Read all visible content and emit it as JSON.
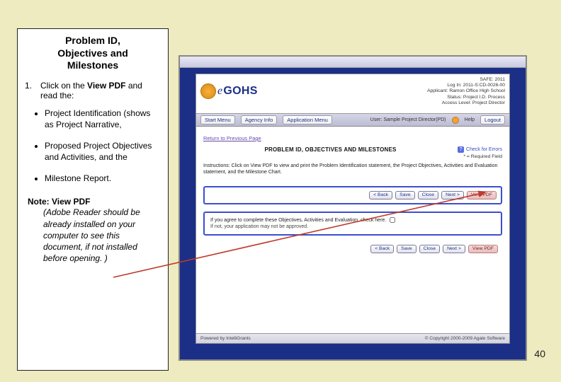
{
  "slide_number": "40",
  "panel": {
    "title_l1": "Problem ID,",
    "title_l2": "Objectives and",
    "title_l3": "Milestones",
    "step_num": "1.",
    "step_prefix": "Click on the ",
    "step_bold": "View PDF",
    "step_suffix": " and read  the:",
    "bullets": [
      "Project Identification (shows as Project Narrative,",
      "Proposed Project Objectives and Activities, and the",
      "Milestone Report."
    ],
    "note_label": "Note: View PDF ",
    "note_body": "(Adobe Reader should be already installed on your computer to see this document, if not installed before opening. )"
  },
  "app": {
    "brand_e": "e",
    "brand_rest": "GOHS",
    "meta": [
      "SAFE: 2011",
      "Log In: 2011-S:CD-0026-00",
      "Applicant: Ramon Office High School",
      "Status: Project I.D. Process",
      "Access Level: Project Director"
    ],
    "nav": {
      "left": [
        "Start Menu",
        "Agency Info",
        "Application Menu"
      ],
      "user": "User: Sample Project Director(PD)",
      "help": "Help",
      "logout": "Logout"
    },
    "breadcrumb": "Return to Previous Page",
    "page_title": "PROBLEM ID, OBJECTIVES AND MILESTONES",
    "check_errors": "Check for Errors",
    "required": "* = Required Field",
    "instructions": "Instructions: Click on View PDF to view and print the Problem Identification statement, the Project Objectives, Activities and Evaluation statement, and the Milestone Chart.",
    "buttons": [
      "< Back",
      "Save",
      "Close",
      "Next >",
      "View PDF"
    ],
    "agree_l1": "If you agree to complete these Objectives, Activities and Evaluation, check here.",
    "agree_l2": "If not, your application may not be approved.",
    "footer_left": "Powered by IntelliGrants",
    "footer_right": "© Copyright 2000-2009 Agate Software"
  }
}
